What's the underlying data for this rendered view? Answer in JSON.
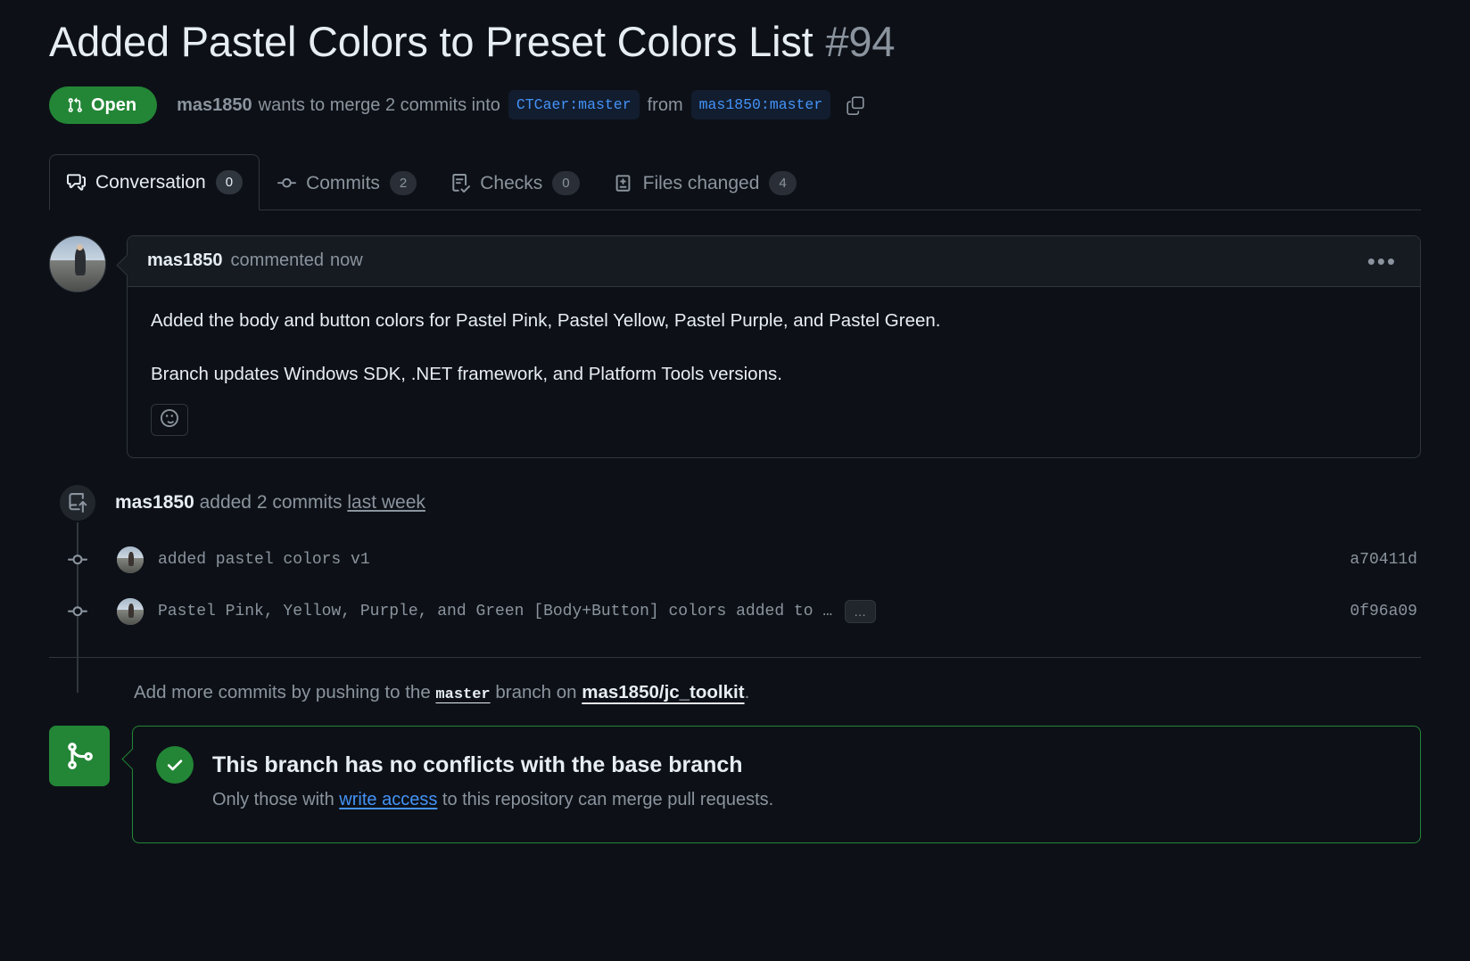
{
  "header": {
    "title": "Added Pastel Colors to Preset Colors List",
    "number": "#94",
    "state": "Open",
    "state_color": "#238636",
    "actor": "mas1850",
    "merge_text": "wants to merge 2 commits into",
    "base_branch": "CTCaer:master",
    "from_word": "from",
    "head_branch": "mas1850:master",
    "copy_icon": "copy-icon"
  },
  "tabs": [
    {
      "label": "Conversation",
      "count": "0",
      "icon": "comment-discussion-icon",
      "active": true
    },
    {
      "label": "Commits",
      "count": "2",
      "icon": "git-commit-icon",
      "active": false
    },
    {
      "label": "Checks",
      "count": "0",
      "icon": "checklist-icon",
      "active": false
    },
    {
      "label": "Files changed",
      "count": "4",
      "icon": "file-diff-icon",
      "active": false
    }
  ],
  "comment": {
    "author": "mas1850",
    "action": "commented",
    "time": "now",
    "menu_icon": "kebab-horizontal-icon",
    "paragraphs": [
      "Added the body and button colors for Pastel Pink, Pastel Yellow, Pastel Purple, and Pastel Green.",
      "Branch updates Windows SDK, .NET framework, and Platform Tools versions."
    ],
    "reaction_icon": "smiley-icon"
  },
  "timeline": {
    "event": {
      "icon": "repo-push-icon",
      "author": "mas1850",
      "text": "added 2 commits",
      "time_link": "last week"
    },
    "commits": [
      {
        "node_icon": "git-commit-icon",
        "avatar": "avatar",
        "message": "added pastel colors v1",
        "has_ellipsis": false,
        "ellipsis_label": "",
        "sha": "a70411d"
      },
      {
        "node_icon": "git-commit-icon",
        "avatar": "avatar",
        "message": "Pastel Pink, Yellow, Purple, and Green [Body+Button] colors added to …",
        "has_ellipsis": true,
        "ellipsis_label": "…",
        "sha": "0f96a09"
      }
    ]
  },
  "push_hint": {
    "prefix": "Add more commits by pushing to the",
    "branch": "master",
    "middle": "branch on",
    "repo": "mas1850/jc_toolkit",
    "suffix": "."
  },
  "merge_status": {
    "icon": "git-merge-icon",
    "check_icon": "check-icon",
    "title": "This branch has no conflicts with the base branch",
    "subtitle_prefix": "Only those with",
    "subtitle_link": "write access",
    "subtitle_suffix": "to this repository can merge pull requests.",
    "border_color": "#238636"
  }
}
